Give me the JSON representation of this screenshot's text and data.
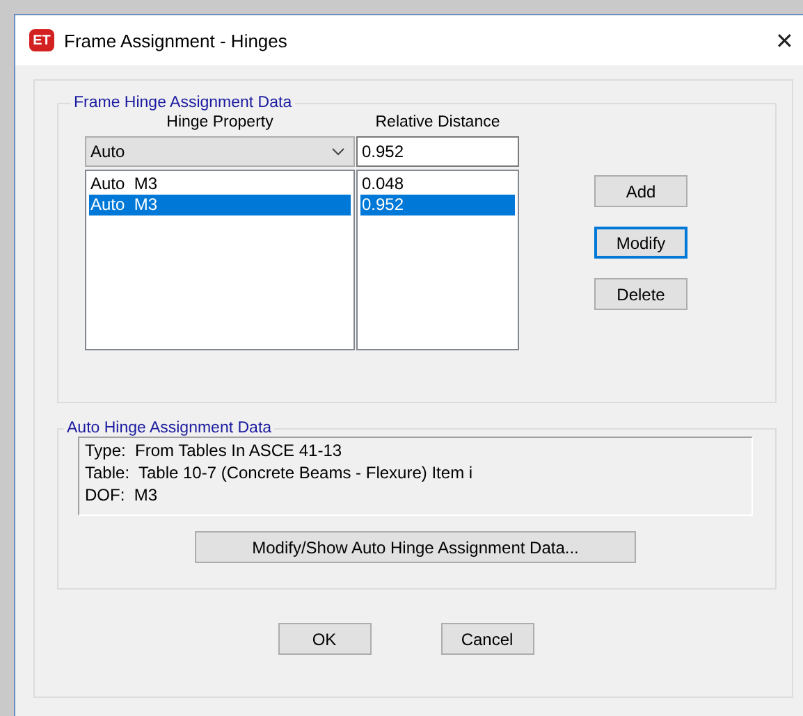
{
  "window": {
    "title": "Frame Assignment - Hinges",
    "app_badge": "ET",
    "close": "✕"
  },
  "hinge_group": {
    "title": "Frame Hinge Assignment Data",
    "columns": [
      "Hinge Property",
      "Relative Distance"
    ],
    "property_dropdown": {
      "value": "Auto"
    },
    "distance_field": {
      "value": "0.952"
    },
    "rows": [
      {
        "property": "Auto  M3",
        "distance": "0.048",
        "selected": false
      },
      {
        "property": "Auto  M3",
        "distance": "0.952",
        "selected": true
      }
    ],
    "buttons": [
      {
        "label": "Add",
        "focused": false
      },
      {
        "label": "Modify",
        "focused": true
      },
      {
        "label": "Delete",
        "focused": false
      }
    ]
  },
  "auto_group": {
    "title": "Auto Hinge Assignment Data",
    "lines": [
      "Type:  From Tables In ASCE 41-13",
      "Table:  Table 10-7 (Concrete Beams - Flexure) Item i",
      "DOF:  M3"
    ],
    "button": "Modify/Show Auto Hinge Assignment Data..."
  },
  "buttons": [
    "OK",
    "Cancel"
  ]
}
